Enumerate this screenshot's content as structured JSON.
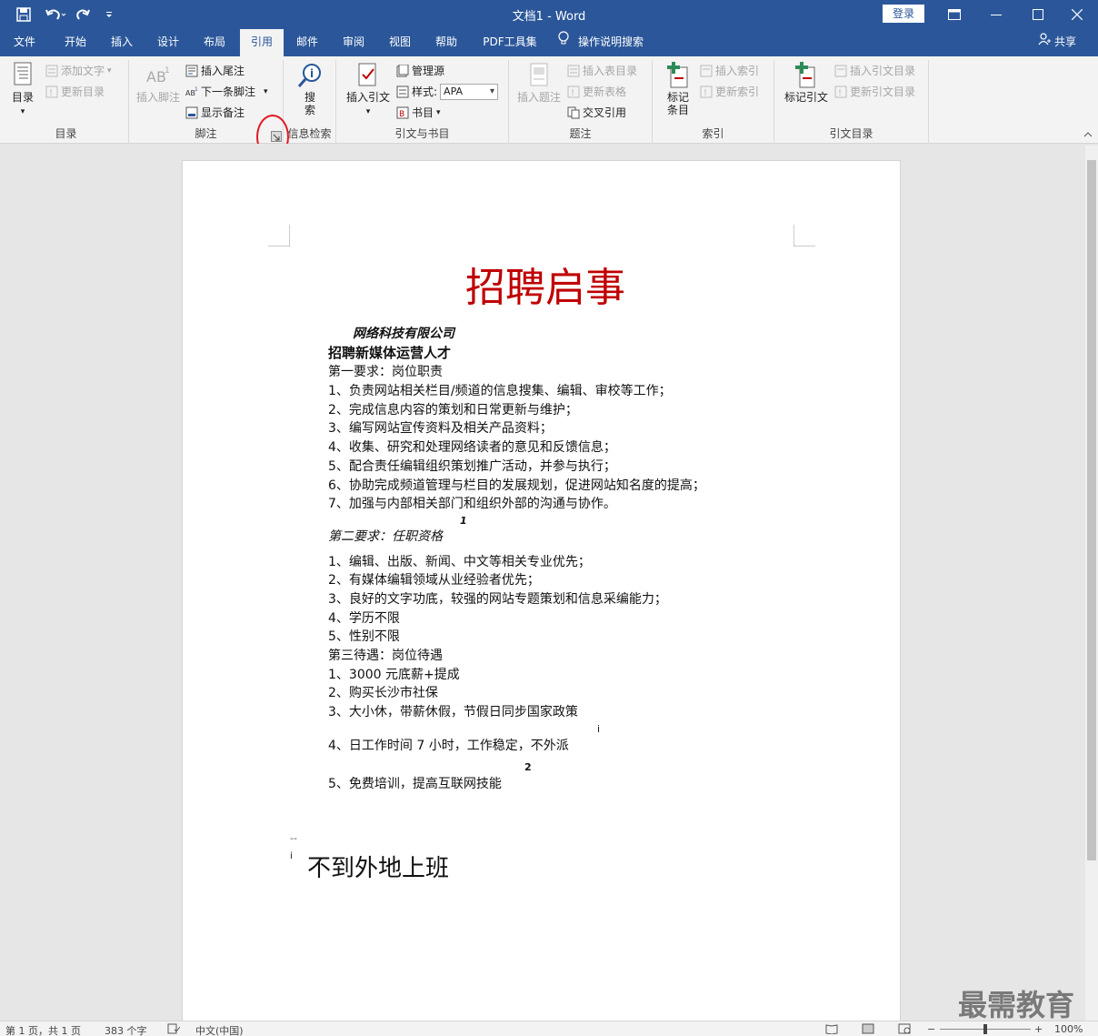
{
  "window": {
    "title": "文档1  -  Word",
    "login_label": "登录"
  },
  "tabs": [
    "文件",
    "开始",
    "插入",
    "设计",
    "布局",
    "引用",
    "邮件",
    "审阅",
    "视图",
    "帮助",
    "PDF工具集"
  ],
  "active_tab": "引用",
  "tell_me": "操作说明搜索",
  "share": "共享",
  "ribbon": {
    "toc": {
      "big": "目录",
      "add_text": "添加文字",
      "update": "更新目录",
      "label": "目录"
    },
    "footnotes": {
      "insert_footnote": "插入脚注",
      "insert_endnote": "插入尾注",
      "next_footnote": "下一条脚注",
      "show_notes": "显示备注",
      "label": "脚注"
    },
    "research": {
      "search": "搜索",
      "label": "信息检索"
    },
    "citations": {
      "insert_citation": "插入引文",
      "manage_sources": "管理源",
      "style_label": "样式:",
      "style_value": "APA",
      "bibliography": "书目",
      "label": "引文与书目"
    },
    "captions": {
      "insert_caption": "插入题注",
      "insert_table_figures": "插入表目录",
      "update_table": "更新表格",
      "cross_reference": "交叉引用",
      "label": "题注"
    },
    "index": {
      "mark_entry": "标记条目",
      "insert_index": "插入索引",
      "update_index": "更新索引",
      "label": "索引"
    },
    "toa": {
      "mark_citation": "标记引文",
      "insert_toa": "插入引文目录",
      "update_toa": "更新引文目录",
      "label": "引文目录"
    }
  },
  "document": {
    "title": "招聘启事",
    "company": "网络科技有限公司",
    "position": "招聘新媒体运营人才",
    "req1_heading": "第一要求：岗位职责",
    "req1_items": [
      "1、负责网站相关栏目/频道的信息搜集、编辑、审校等工作；",
      "2、完成信息内容的策划和日常更新与维护；",
      "3、编写网站宣传资料及相关产品资料；",
      "4、收集、研究和处理网络读者的意见和反馈信息；",
      "5、配合责任编辑组织策划推广活动，并参与执行；",
      "6、协助完成频道管理与栏目的发展规划，促进网站知名度的提高；",
      "7、加强与内部相关部门和组织外部的沟通与协作。"
    ],
    "req2_heading": "第二要求：任职资格",
    "footnote_mark_1": "1",
    "req2_items": [
      "1、编辑、出版、新闻、中文等相关专业优先；",
      "2、有媒体编辑领域从业经验者优先；",
      "3、良好的文字功底，较强的网站专题策划和信息采编能力；",
      "4、学历不限",
      "5、性别不限"
    ],
    "req3_heading": "第三待遇：岗位待遇",
    "req3_items": [
      "1、3000 元底薪+提成",
      "2、购买长沙市社保",
      "3、大小休，带薪休假，节假日同步国家政策"
    ],
    "item4": "4、日工作时间 7 小时，工作稳定，不外派",
    "endnote_mark_i": "i",
    "item5": "5、免费培训，提高互联网技能",
    "footnote_mark_2": "2",
    "separator": "--",
    "endnote_label": "i",
    "endnote_text": "不到外地上班"
  },
  "statusbar": {
    "page": "第 1 页，共 1 页",
    "words": "383 个字",
    "language": "中文(中国)",
    "zoom": "100%",
    "zoom_minus": "−",
    "zoom_plus": "+"
  },
  "watermark": "最需教育",
  "colors": {
    "brand": "#2b579a",
    "title_red": "#c00000",
    "highlight": "#e01b24"
  }
}
